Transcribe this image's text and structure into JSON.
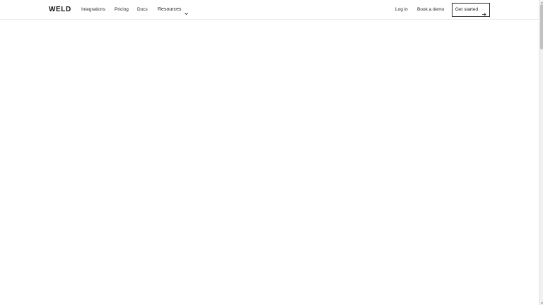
{
  "brand": {
    "logo_text": "WELD"
  },
  "nav": {
    "integrations": "Integrations",
    "pricing": "Pricing",
    "docs": "Docs",
    "resources": "Resources",
    "login": "Log in",
    "book_demo": "Book a demo",
    "get_started": "Get started"
  },
  "icons": {
    "resources_dropdown": "chevron-down-icon",
    "cta_arrow": "arrow-right-icon"
  },
  "colors": {
    "text": "#1a1a1a",
    "border": "#2a2a2a",
    "background": "#ffffff"
  }
}
